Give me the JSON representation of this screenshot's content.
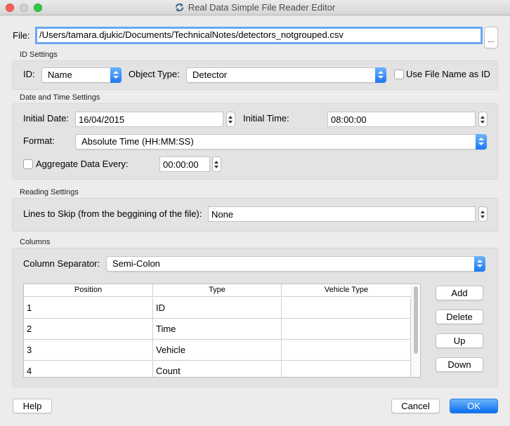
{
  "window": {
    "title": "Real Data Simple File Reader Editor"
  },
  "file": {
    "label": "File:",
    "path": "/Users/tamara.djukic/Documents/TechnicalNotes/detectors_notgrouped.csv",
    "browse_label": "..."
  },
  "id_settings": {
    "group_label": "ID Settings",
    "id_label": "ID:",
    "id_value": "Name",
    "object_type_label": "Object Type:",
    "object_type_value": "Detector",
    "use_filename_label": "Use File Name as ID"
  },
  "datetime": {
    "group_label": "Date and Time Settings",
    "initial_date_label": "Initial Date:",
    "initial_date_value": "16/04/2015",
    "initial_time_label": "Initial Time:",
    "initial_time_value": "08:00:00",
    "format_label": "Format:",
    "format_value": "Absolute Time (HH:MM:SS)",
    "aggregate_label": "Aggregate Data Every:",
    "aggregate_value": "00:00:00"
  },
  "reading": {
    "group_label": "Reading Settings",
    "lines_label": "Lines to Skip (from the beggining of the file):",
    "lines_value": "None"
  },
  "columns": {
    "group_label": "Columns",
    "separator_label": "Column Separator:",
    "separator_value": "Semi-Colon",
    "headers": [
      "Position",
      "Type",
      "Vehicle Type"
    ],
    "rows": [
      {
        "position": "1",
        "type": "ID",
        "vehicle_type": ""
      },
      {
        "position": "2",
        "type": "Time",
        "vehicle_type": ""
      },
      {
        "position": "3",
        "type": "Vehicle",
        "vehicle_type": ""
      },
      {
        "position": "4",
        "type": "Count",
        "vehicle_type": ""
      }
    ],
    "add_label": "Add",
    "delete_label": "Delete",
    "up_label": "Up",
    "down_label": "Down"
  },
  "footer": {
    "help_label": "Help",
    "cancel_label": "Cancel",
    "ok_label": "OK"
  }
}
